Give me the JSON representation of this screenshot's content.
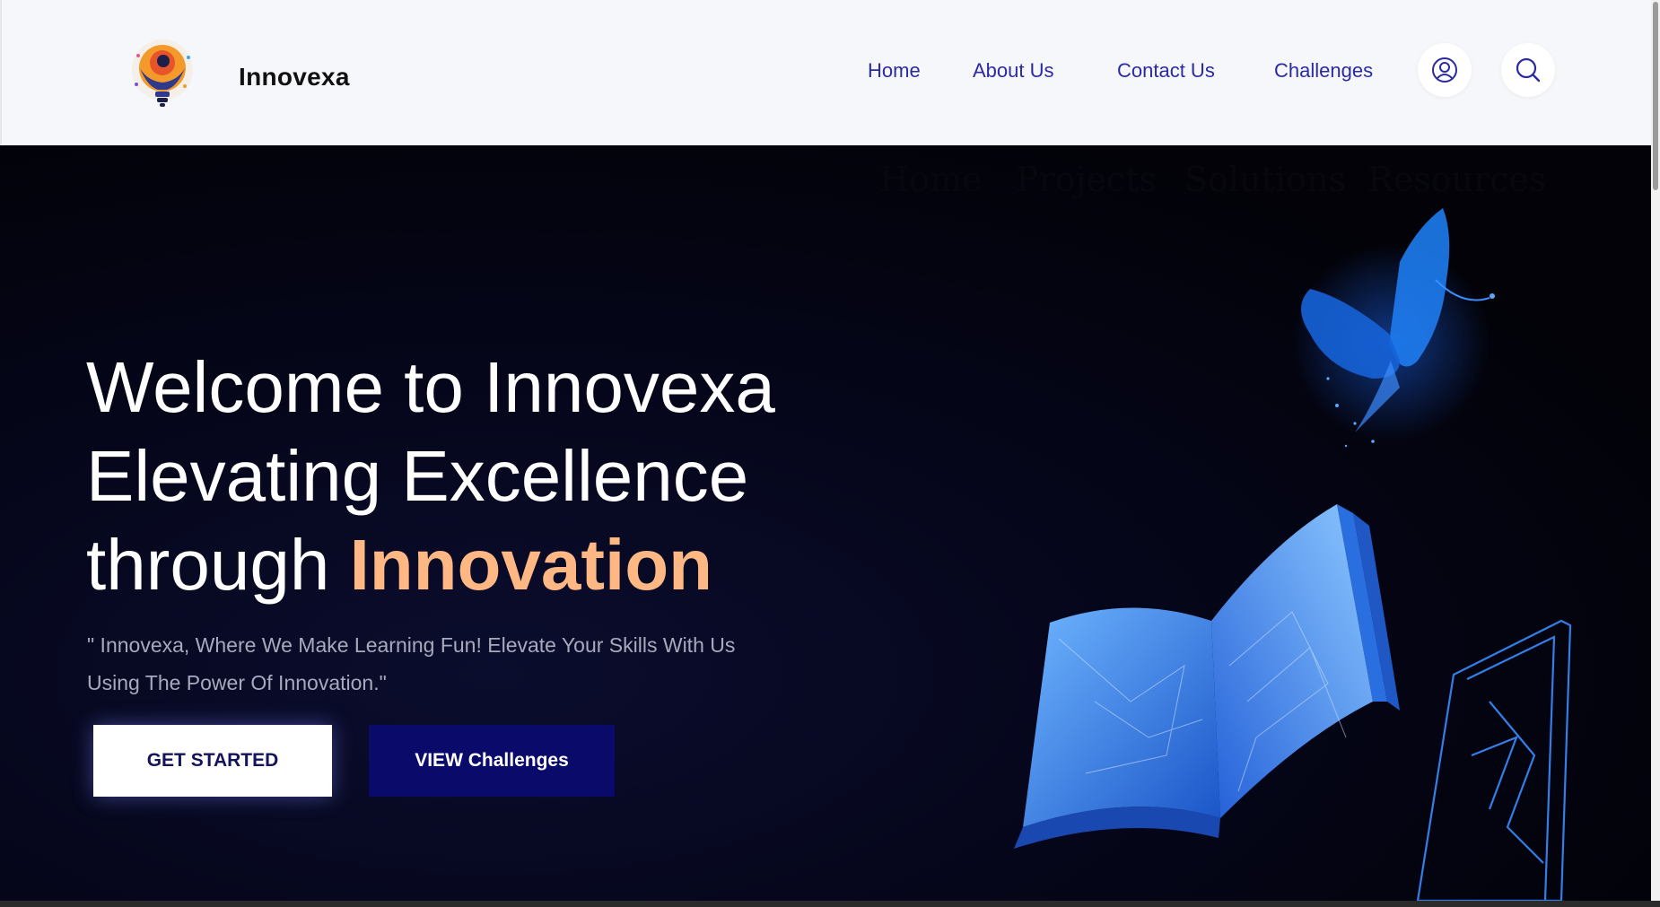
{
  "header": {
    "brand": "Innovexa",
    "nav": [
      "Home",
      "About Us",
      "Contact Us",
      "Challenges"
    ],
    "icons": [
      "user-icon",
      "search-icon"
    ],
    "nav_color": "#2c2aa3"
  },
  "hero": {
    "ghost_nav": [
      "Home",
      "Projects",
      "Solutions",
      "Resources"
    ],
    "headline_line1": "Welcome to Innovexa",
    "headline_line2": "Elevating Excellence",
    "headline_line3_prefix": "through ",
    "headline_accent": "Innovation",
    "accent_color": "#ffb784",
    "tagline": "\" Innovexa, Where We Make Learning Fun! Elevate Your Skills With Us Using The Power Of Innovation.\"",
    "primary_button": "GET STARTED",
    "secondary_button": "VIEW Challenges",
    "illustration": [
      "glowing-butterfly",
      "open-book",
      "tablet-outline"
    ]
  }
}
